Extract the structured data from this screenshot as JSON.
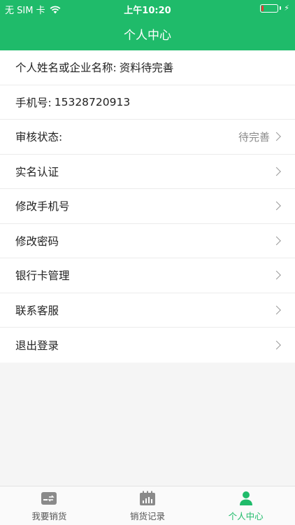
{
  "status_bar": {
    "carrier": "无 SIM 卡",
    "time": "上午10:20"
  },
  "nav": {
    "title": "个人中心"
  },
  "profile": {
    "name_label": "个人姓名或企业名称:",
    "name_value": "资料待完善",
    "phone_label": "手机号:",
    "phone_value": "15328720913",
    "review_label": "审核状态:",
    "review_value": "待完善"
  },
  "menu": [
    {
      "label": "实名认证"
    },
    {
      "label": "修改手机号"
    },
    {
      "label": "修改密码"
    },
    {
      "label": "银行卡管理"
    },
    {
      "label": "联系客服"
    },
    {
      "label": "退出登录"
    }
  ],
  "tabs": [
    {
      "label": "我要销货",
      "icon": "sell-card-icon"
    },
    {
      "label": "销货记录",
      "icon": "records-calendar-icon"
    },
    {
      "label": "个人中心",
      "icon": "person-icon",
      "active": true
    }
  ],
  "colors": {
    "brand": "#1fbb6a",
    "battery_low": "#e53935"
  }
}
